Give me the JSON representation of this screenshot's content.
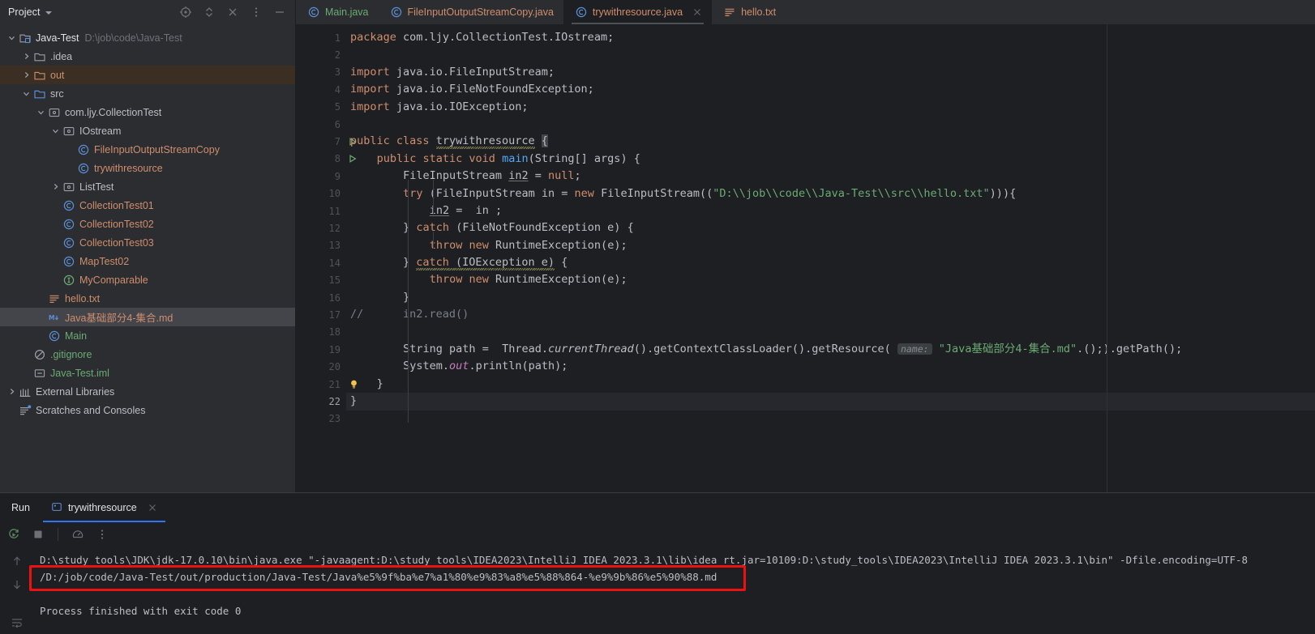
{
  "sidebar": {
    "title": "Project",
    "tools": [
      "locate-icon",
      "expand-collapse-icon",
      "close-all-icon",
      "more-options-icon",
      "hide-icon"
    ],
    "tree": [
      {
        "label": "Java-Test",
        "sub": "D:\\job\\code\\Java-Test",
        "icon": "module-icon",
        "indent": 0,
        "twisty": "down",
        "color": "white",
        "state": "normal"
      },
      {
        "label": ".idea",
        "sub": "",
        "icon": "folder-icon",
        "indent": 1,
        "twisty": "right",
        "color": "grey",
        "state": "normal"
      },
      {
        "label": "out",
        "sub": "",
        "icon": "folder-excluded-icon",
        "indent": 1,
        "twisty": "right",
        "color": "orange",
        "state": "selected-out"
      },
      {
        "label": "src",
        "sub": "",
        "icon": "folder-source-icon",
        "indent": 1,
        "twisty": "down",
        "color": "grey",
        "state": "normal"
      },
      {
        "label": "com.ljy.CollectionTest",
        "sub": "",
        "icon": "package-icon",
        "indent": 2,
        "twisty": "down",
        "color": "grey",
        "state": "normal"
      },
      {
        "label": "IOstream",
        "sub": "",
        "icon": "package-icon",
        "indent": 3,
        "twisty": "down",
        "color": "grey",
        "state": "normal"
      },
      {
        "label": "FileInputOutputStreamCopy",
        "sub": "",
        "icon": "java-class-icon",
        "indent": 4,
        "twisty": "none",
        "color": "orange",
        "state": "normal"
      },
      {
        "label": "trywithresource",
        "sub": "",
        "icon": "java-class-icon",
        "indent": 4,
        "twisty": "none",
        "color": "orange",
        "state": "normal"
      },
      {
        "label": "ListTest",
        "sub": "",
        "icon": "package-icon",
        "indent": 3,
        "twisty": "right",
        "color": "grey",
        "state": "normal"
      },
      {
        "label": "CollectionTest01",
        "sub": "",
        "icon": "java-class-icon",
        "indent": 3,
        "twisty": "none",
        "color": "orange",
        "state": "normal"
      },
      {
        "label": "CollectionTest02",
        "sub": "",
        "icon": "java-class-icon",
        "indent": 3,
        "twisty": "none",
        "color": "orange",
        "state": "normal"
      },
      {
        "label": "CollectionTest03",
        "sub": "",
        "icon": "java-class-icon",
        "indent": 3,
        "twisty": "none",
        "color": "orange",
        "state": "normal"
      },
      {
        "label": "MapTest02",
        "sub": "",
        "icon": "java-class-icon",
        "indent": 3,
        "twisty": "none",
        "color": "orange",
        "state": "normal"
      },
      {
        "label": "MyComparable",
        "sub": "",
        "icon": "java-interface-icon",
        "indent": 3,
        "twisty": "none",
        "color": "orange",
        "state": "normal"
      },
      {
        "label": "hello.txt",
        "sub": "",
        "icon": "text-file-icon",
        "indent": 2,
        "twisty": "none",
        "color": "orange",
        "state": "normal"
      },
      {
        "label": "Java基础部分4-集合.md",
        "sub": "",
        "icon": "markdown-icon",
        "indent": 2,
        "twisty": "none",
        "color": "orange",
        "state": "selected-md"
      },
      {
        "label": "Main",
        "sub": "",
        "icon": "java-class-icon",
        "indent": 2,
        "twisty": "none",
        "color": "green",
        "state": "normal"
      },
      {
        "label": ".gitignore",
        "sub": "",
        "icon": "gitignore-icon",
        "indent": 1,
        "twisty": "none",
        "color": "green",
        "state": "normal"
      },
      {
        "label": "Java-Test.iml",
        "sub": "",
        "icon": "iml-icon",
        "indent": 1,
        "twisty": "none",
        "color": "green",
        "state": "normal"
      },
      {
        "label": "External Libraries",
        "sub": "",
        "icon": "libraries-icon",
        "indent": 0,
        "twisty": "right",
        "color": "grey",
        "state": "normal"
      },
      {
        "label": "Scratches and Consoles",
        "sub": "",
        "icon": "scratches-icon",
        "indent": 0,
        "twisty": "none",
        "color": "grey",
        "state": "normal"
      }
    ]
  },
  "editor": {
    "tabs": [
      {
        "label": "Main.java",
        "icon": "java-class-icon",
        "color": "green",
        "active": false,
        "closable": false
      },
      {
        "label": "FileInputOutputStreamCopy.java",
        "icon": "java-class-icon",
        "color": "orange",
        "active": false,
        "closable": false
      },
      {
        "label": "trywithresource.java",
        "icon": "java-class-icon",
        "color": "orange",
        "active": true,
        "closable": true
      },
      {
        "label": "hello.txt",
        "icon": "text-file-icon",
        "color": "orange",
        "active": false,
        "closable": false
      }
    ],
    "line_numbers": [
      "1",
      "2",
      "3",
      "4",
      "5",
      "6",
      "7",
      "8",
      "9",
      "10",
      "11",
      "12",
      "13",
      "14",
      "15",
      "16",
      "17",
      "18",
      "19",
      "20",
      "21",
      "22",
      "23"
    ],
    "current_line": "22",
    "gutter_run_lines": [
      "7",
      "8"
    ],
    "gutter_bulb_line": "21",
    "code_lines": [
      "package com.ljy.CollectionTest.IOstream;",
      "",
      "import java.io.FileInputStream;",
      "import java.io.FileNotFoundException;",
      "import java.io.IOException;",
      "",
      "public class trywithresource {",
      "    public static void main(String[] args) {",
      "        FileInputStream in2 = null;",
      "        try (FileInputStream in = new FileInputStream((\"D:\\\\job\\\\code\\\\Java-Test\\\\src\\\\hello.txt\"))){",
      "            in2 =  in ;",
      "        } catch (FileNotFoundException e) {",
      "            throw new RuntimeException(e);",
      "        } catch (IOException e) {",
      "            throw new RuntimeException(e);",
      "        }",
      "//      in2.read()",
      "",
      "        String path =  Thread.currentThread().getContextClassLoader().getResource( name: \"Java基础部分4-集合.md\").getPath();",
      "        System.out.println(path);",
      "    }",
      "}",
      ""
    ],
    "inlay_hint_name": "name:",
    "resource_string": "\"Java基础部分4-集合.md\"",
    "file_path_string": "\"D:\\\\job\\\\code\\\\Java-Test\\\\src\\\\hello.txt\""
  },
  "run_panel": {
    "title": "Run",
    "tab_label": "trywithresource",
    "tab_icon": "run-config-icon",
    "toolbar": [
      "rerun-icon",
      "stop-icon",
      "profiler-icon",
      "more-options-icon"
    ],
    "side_tools": [
      "scroll-up-icon",
      "scroll-down-icon",
      "soft-wrap-icon"
    ],
    "console_lines": [
      "D:\\study tools\\JDK\\jdk-17.0.10\\bin\\java.exe \"-javaagent:D:\\study tools\\IDEA2023\\IntelliJ IDEA 2023.3.1\\lib\\idea_rt.jar=10109:D:\\study_tools\\IDEA2023\\IntelliJ IDEA 2023.3.1\\bin\" -Dfile.encoding=UTF-8",
      "/D:/job/code/Java-Test/out/production/Java-Test/Java%e5%9f%ba%e7%a1%80%e9%83%a8%e5%88%864-%e9%9b%86%e5%90%88.md",
      "",
      "Process finished with exit code 0"
    ],
    "highlight_color": "#ee1111"
  }
}
